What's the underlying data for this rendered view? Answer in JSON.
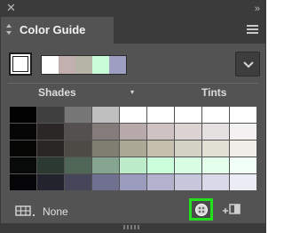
{
  "window": {
    "close_glyph": "✕",
    "collapse_glyph": "»"
  },
  "tab": {
    "title": "Color Guide"
  },
  "guide": {
    "base_color": "#ffffff",
    "harmony_colors": [
      "#ffffff",
      "#c2b0b0",
      "#b6b4a6",
      "#c9fcd9",
      "#9e9ec2"
    ]
  },
  "header": {
    "left": "Shades",
    "middle": "▾",
    "right": "Tints"
  },
  "variations": [
    [
      "#020202",
      "#3f3f3f",
      "#777777",
      "#bfbfbf",
      "#ffffff",
      "#ffffff",
      "#ffffff",
      "#ffffff",
      "#ffffff"
    ],
    [
      "#070606",
      "#2c2727",
      "#555050",
      "#857b7b",
      "#b8aaaa",
      "#cfc2c2",
      "#dcd3d3",
      "#e6e1e1",
      "#f3f1f1"
    ],
    [
      "#060605",
      "#282723",
      "#4b4a44",
      "#807d71",
      "#aba895",
      "#c4c0ad",
      "#d4d2c4",
      "#e2dfd5",
      "#efeee8"
    ],
    [
      "#070a08",
      "#2c3930",
      "#4f6656",
      "#86a591",
      "#bcecc9",
      "#cbffdc",
      "#d8ffe4",
      "#e5ffed",
      "#f2fff6"
    ],
    [
      "#050508",
      "#23232e",
      "#46465a",
      "#707090",
      "#9b9bbd",
      "#b2b2cf",
      "#c7c7dc",
      "#d9d9e8",
      "#ecedf4"
    ]
  ],
  "footer": {
    "limit_label": "None"
  }
}
